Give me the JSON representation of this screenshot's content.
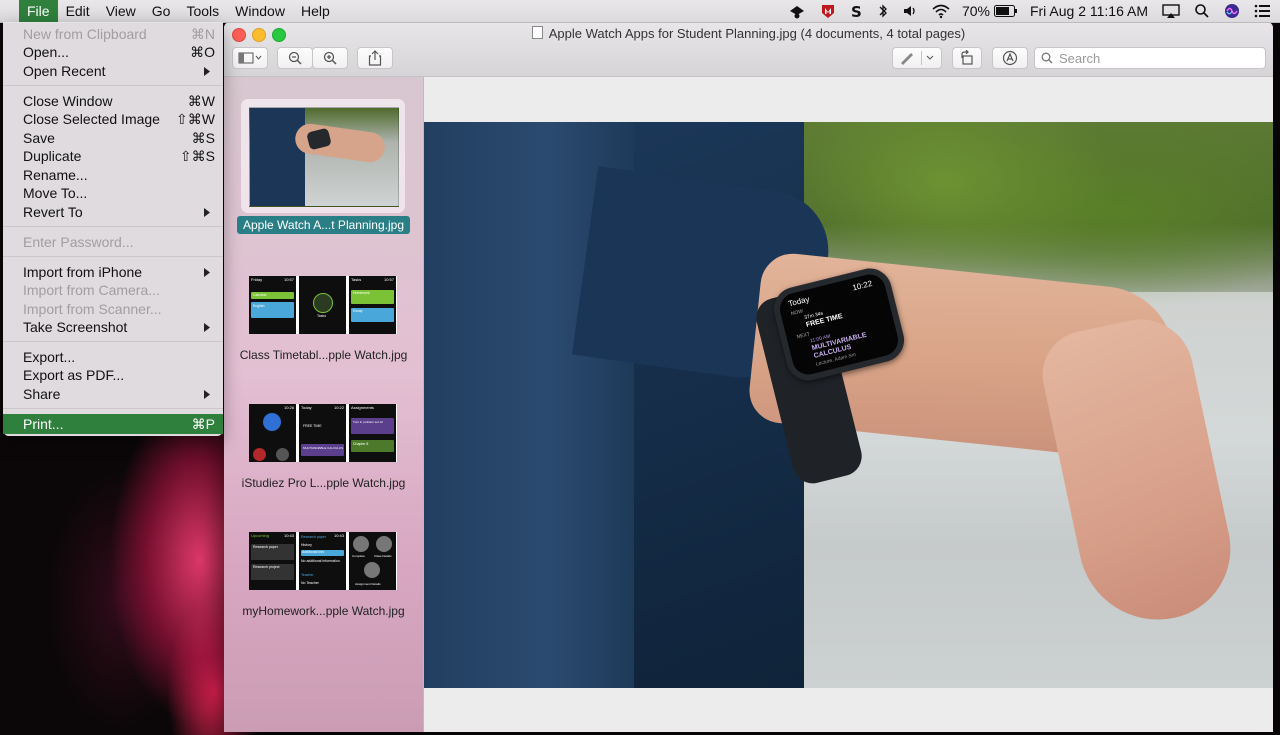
{
  "menubar": {
    "menus": [
      "File",
      "Edit",
      "View",
      "Go",
      "Tools",
      "Window",
      "Help"
    ],
    "active_menu": "File",
    "battery": "70%",
    "clock": "Fri Aug 2  11:16 AM"
  },
  "file_menu": {
    "items": [
      {
        "label": "New from Clipboard",
        "shortcut": "⌘N"
      },
      {
        "label": "Open...",
        "shortcut": "⌘O"
      },
      {
        "label": "Open Recent",
        "shortcut": ""
      },
      {
        "label": "Close Window",
        "shortcut": "⌘W"
      },
      {
        "label": "Close Selected Image",
        "shortcut": "⇧⌘W"
      },
      {
        "label": "Save",
        "shortcut": "⌘S"
      },
      {
        "label": "Duplicate",
        "shortcut": "⇧⌘S"
      },
      {
        "label": "Rename...",
        "shortcut": ""
      },
      {
        "label": "Move To...",
        "shortcut": ""
      },
      {
        "label": "Revert To",
        "shortcut": ""
      },
      {
        "label": "Enter Password...",
        "shortcut": ""
      },
      {
        "label": "Import from iPhone",
        "shortcut": ""
      },
      {
        "label": "Import from Camera...",
        "shortcut": ""
      },
      {
        "label": "Import from Scanner...",
        "shortcut": ""
      },
      {
        "label": "Take Screenshot",
        "shortcut": ""
      },
      {
        "label": "Export...",
        "shortcut": ""
      },
      {
        "label": "Export as PDF...",
        "shortcut": ""
      },
      {
        "label": "Share",
        "shortcut": ""
      },
      {
        "label": "Print...",
        "shortcut": "⌘P"
      }
    ]
  },
  "window": {
    "title": "Apple Watch Apps for Student Planning.jpg (4 documents, 4 total pages)",
    "search_placeholder": "Search"
  },
  "sidebar": {
    "thumbnails": [
      {
        "caption": "Apple Watch A...t Planning.jpg",
        "selected": true
      },
      {
        "caption": "Class Timetabl...pple Watch.jpg",
        "selected": false
      },
      {
        "caption": "iStudiez Pro L...pple Watch.jpg",
        "selected": false
      },
      {
        "caption": "myHomework...pple Watch.jpg",
        "selected": false
      }
    ]
  },
  "thumb_text": {
    "t2": {
      "time": "10:57",
      "day": "Friday",
      "tasks": "Tasks",
      "homework": "Homework",
      "essay": "Essay",
      "tasks_label": "Tasks",
      "calculus": "Calculus",
      "english": "English"
    },
    "t3": {
      "time1": "10:26",
      "time2": "10:22",
      "today": "Today",
      "free": "FREE TIME",
      "multi": "MULTIVARIABLE CALCULUS",
      "assignments": "Assignments",
      "turn_in": "Turn in problem set 12",
      "chapter": "Chapter 8"
    },
    "t4": {
      "time": "10:43",
      "upcoming": "Upcoming",
      "research_paper": "Research paper",
      "research_project": "Research project",
      "rp_title": "Research paper",
      "history": "History",
      "additional": "Additional Info",
      "no_info": "No additional information.",
      "teacher": "Teacher",
      "no_teacher": "No Teacher",
      "complete": "Complete",
      "class_details": "Class Details",
      "assignment_details": "Assignment Details"
    }
  },
  "photo_watch": {
    "today": "Today",
    "time": "10:22",
    "now": "NOW",
    "countdown": "37m 34s",
    "free_time": "FREE TIME",
    "next": "NEXT",
    "next_time": "11:00 AM",
    "subject1": "MULTIVARIABLE",
    "subject2": "CALCULUS",
    "detail": "Lecture, Adam Sm"
  },
  "colors": {
    "menu_highlight": "#2f7f3d",
    "selection_caption": "#2a7f86",
    "close": "#fc5f57",
    "minimize": "#fdbc2e",
    "zoom": "#28c840"
  }
}
